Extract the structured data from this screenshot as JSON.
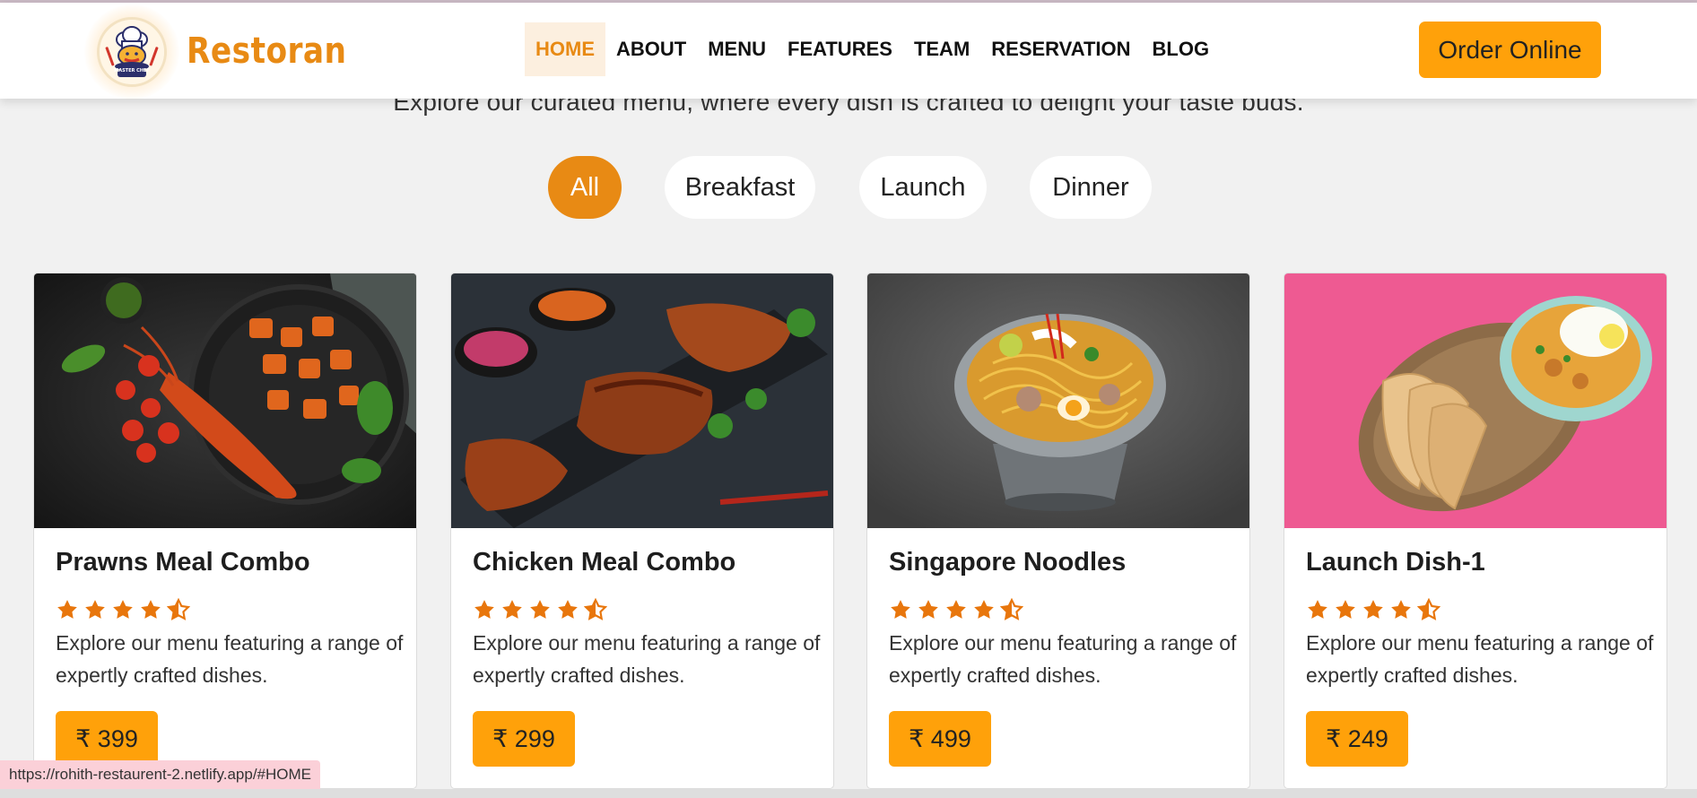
{
  "header": {
    "brand": "Restoran",
    "logo_text": "MASTER CHEF",
    "nav": [
      "HOME",
      "ABOUT",
      "MENU",
      "FEATURES",
      "TEAM",
      "RESERVATION",
      "BLOG"
    ],
    "active_nav": "HOME",
    "order_label": "Order Online"
  },
  "menu": {
    "subtitle": "Explore our curated menu, where every dish is crafted to delight your taste buds.",
    "filters": [
      "All",
      "Breakfast",
      "Launch",
      "Dinner"
    ],
    "active_filter": "All",
    "cards": [
      {
        "title": "Prawns Meal Combo",
        "rating": 4.5,
        "desc": "Explore our menu featuring a range of expertly crafted dishes.",
        "price": "₹ 399"
      },
      {
        "title": "Chicken Meal Combo",
        "rating": 4.5,
        "desc": "Explore our menu featuring a range of expertly crafted dishes.",
        "price": "₹ 299"
      },
      {
        "title": "Singapore Noodles",
        "rating": 4.5,
        "desc": "Explore our menu featuring a range of expertly crafted dishes.",
        "price": "₹ 499"
      },
      {
        "title": "Launch Dish-1",
        "rating": 4.5,
        "desc": "Explore our menu featuring a range of expertly crafted dishes.",
        "price": "₹ 249"
      }
    ]
  },
  "status_url": "https://rohith-restaurent-2.netlify.app/#HOME",
  "colors": {
    "accent": "#e88a14",
    "button": "#ffa10a",
    "star": "#e8760c",
    "background": "#f1f1f1"
  }
}
